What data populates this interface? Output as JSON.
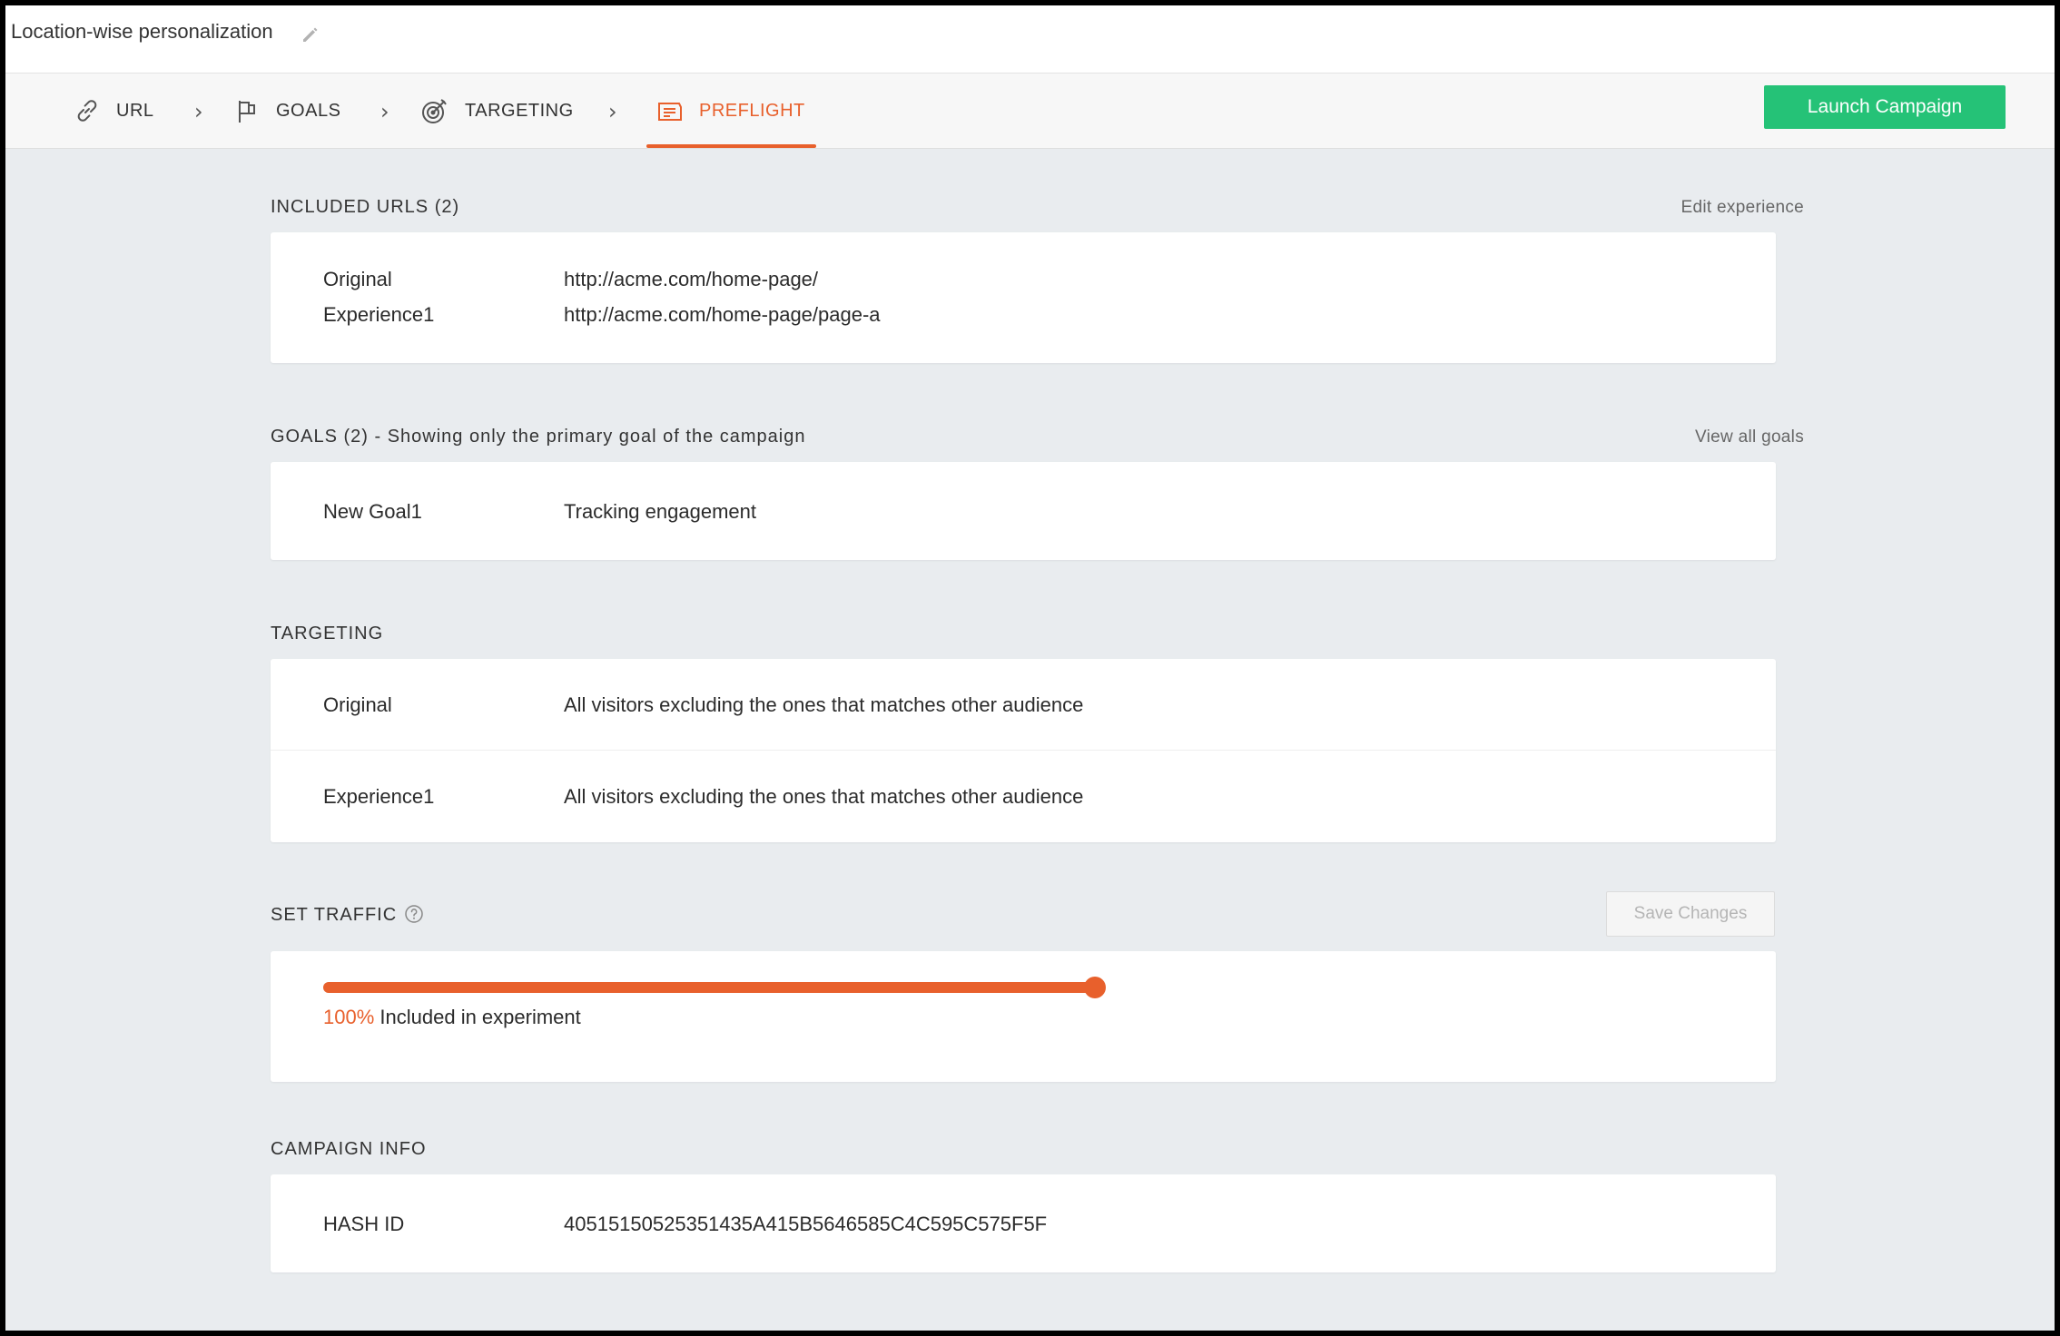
{
  "header": {
    "campaign_name": "Location-wise personalization",
    "launch_label": "Launch Campaign"
  },
  "steps": [
    {
      "label": "URL",
      "icon": "link-icon",
      "active": false
    },
    {
      "label": "GOALS",
      "icon": "flag-icon",
      "active": false
    },
    {
      "label": "TARGETING",
      "icon": "target-icon",
      "active": false
    },
    {
      "label": "PREFLIGHT",
      "icon": "preflight-icon",
      "active": true
    }
  ],
  "included_urls": {
    "title": "INCLUDED URLS (2)",
    "action": "Edit experience",
    "rows": [
      {
        "key": "Original",
        "value": "http://acme.com/home-page/"
      },
      {
        "key": "Experience1",
        "value": "http://acme.com/home-page/page-a"
      }
    ]
  },
  "goals": {
    "title": "GOALS (2) - Showing only the primary goal of the campaign",
    "action": "View all goals",
    "rows": [
      {
        "key": "New Goal1",
        "value": "Tracking engagement"
      }
    ]
  },
  "targeting": {
    "title": "TARGETING",
    "rows": [
      {
        "key": "Original",
        "value": "All visitors excluding the ones that matches other audience"
      },
      {
        "key": "Experience1",
        "value": "All visitors excluding the ones that matches other audience"
      }
    ]
  },
  "traffic": {
    "title": "SET TRAFFIC",
    "save_label": "Save Changes",
    "percent_text": "100%",
    "label": "Included in experiment",
    "value_percent": 100
  },
  "campaign_info": {
    "title": "CAMPAIGN INFO",
    "rows": [
      {
        "key": "HASH ID",
        "value": "40515150525351435A415B5646585C4C595C575F5F"
      }
    ]
  },
  "colors": {
    "accent": "#e8602c",
    "launch_button": "#25c277",
    "page_background": "#e9ecef"
  }
}
